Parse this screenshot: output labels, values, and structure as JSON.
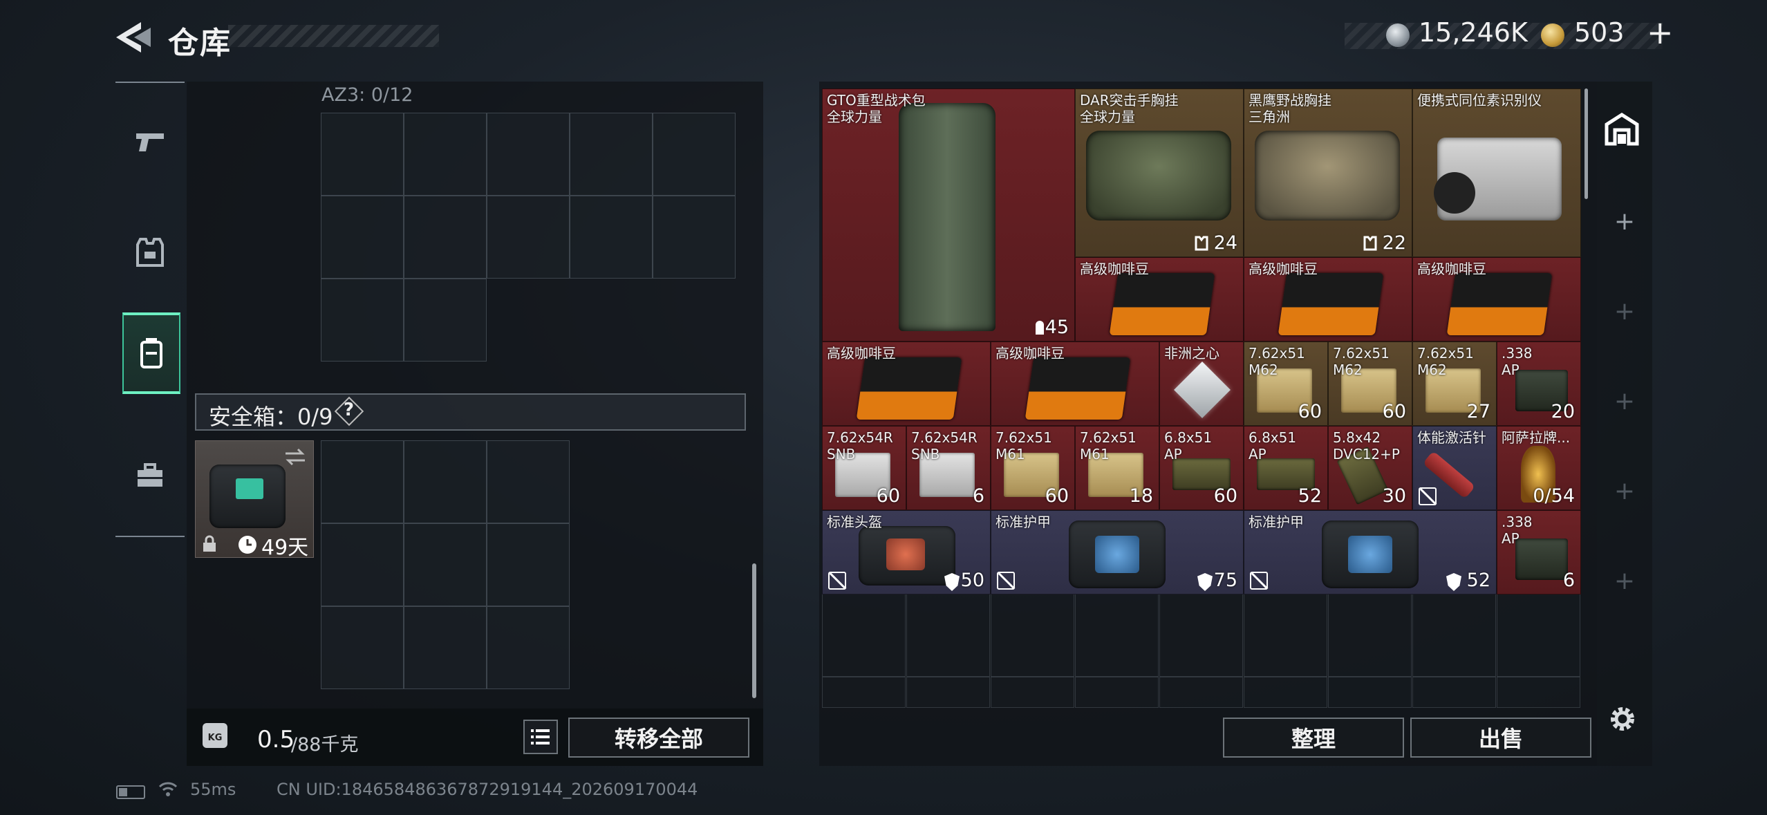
{
  "header": {
    "title": "仓库",
    "silver_amount": "15,246K",
    "gold_amount": "503",
    "plus_label": "+"
  },
  "left_nav": {
    "items": [
      "weapon-icon",
      "armor-icon",
      "backpack-icon",
      "toolbox-icon"
    ],
    "active_index": 2
  },
  "left_panel": {
    "az3_label": "AZ3: 0/12",
    "safe_label": "安全箱：0/9",
    "help_label": "?",
    "safe_item_days": "49天",
    "weight_value": "0.5",
    "weight_max": "/88千克",
    "transfer_all_label": "转移全部"
  },
  "right_panel": {
    "items": [
      {
        "name": "GTO重型战术包\n全球力量",
        "qty": "45",
        "bg": "red"
      },
      {
        "name": "DAR突击手胸挂\n全球力量",
        "qty": "24",
        "bg": "gold"
      },
      {
        "name": "黑鹰野战胸挂\n三角洲",
        "qty": "22",
        "bg": "gold"
      },
      {
        "name": "便携式同位素识别仪",
        "qty": "",
        "bg": "gold"
      },
      {
        "name": "高级咖啡豆",
        "qty": "",
        "bg": "red"
      },
      {
        "name": "高级咖啡豆",
        "qty": "",
        "bg": "red"
      },
      {
        "name": "高级咖啡豆",
        "qty": "",
        "bg": "red"
      },
      {
        "name": "高级咖啡豆",
        "qty": "",
        "bg": "red"
      },
      {
        "name": "高级咖啡豆",
        "qty": "",
        "bg": "red"
      },
      {
        "name": "非洲之心",
        "qty": "",
        "bg": "red"
      },
      {
        "name": "7.62x51\nM62",
        "qty": "60",
        "bg": "gold"
      },
      {
        "name": "7.62x51\nM62",
        "qty": "60",
        "bg": "gold"
      },
      {
        "name": "7.62x51\nM62",
        "qty": "27",
        "bg": "gold"
      },
      {
        "name": ".338\nAP",
        "qty": "20",
        "bg": "red"
      },
      {
        "name": "7.62x54R\nSNB",
        "qty": "60",
        "bg": "red"
      },
      {
        "name": "7.62x54R\nSNB",
        "qty": "6",
        "bg": "red"
      },
      {
        "name": "7.62x51\nM61",
        "qty": "60",
        "bg": "red"
      },
      {
        "name": "7.62x51\nM61",
        "qty": "18",
        "bg": "red"
      },
      {
        "name": "6.8x51\nAP",
        "qty": "60",
        "bg": "red"
      },
      {
        "name": "6.8x51\nAP",
        "qty": "52",
        "bg": "red"
      },
      {
        "name": "5.8x42\nDVC12+P",
        "qty": "30",
        "bg": "red"
      },
      {
        "name": "体能激活针",
        "qty": "",
        "bg": "blue"
      },
      {
        "name": "阿萨拉牌...",
        "qty": "0/54",
        "bg": "red"
      },
      {
        "name": "标准头盔",
        "qty": "50",
        "bg": "blue"
      },
      {
        "name": "标准护甲",
        "qty": "75",
        "bg": "blue"
      },
      {
        "name": "标准护甲",
        "qty": "52",
        "bg": "blue"
      },
      {
        "name": ".338\nAP",
        "qty": "6",
        "bg": "red"
      }
    ],
    "sort_label": "整理",
    "sell_label": "出售"
  },
  "status_bar": {
    "ping": "55ms",
    "uid": "CN UID:184658486367872919144_202609170044"
  },
  "colors": {
    "accent_green": "#3dc59a",
    "tier_red": "#6d2226",
    "tier_gold": "#5e4a2e",
    "tier_blue": "#3a3a55"
  }
}
